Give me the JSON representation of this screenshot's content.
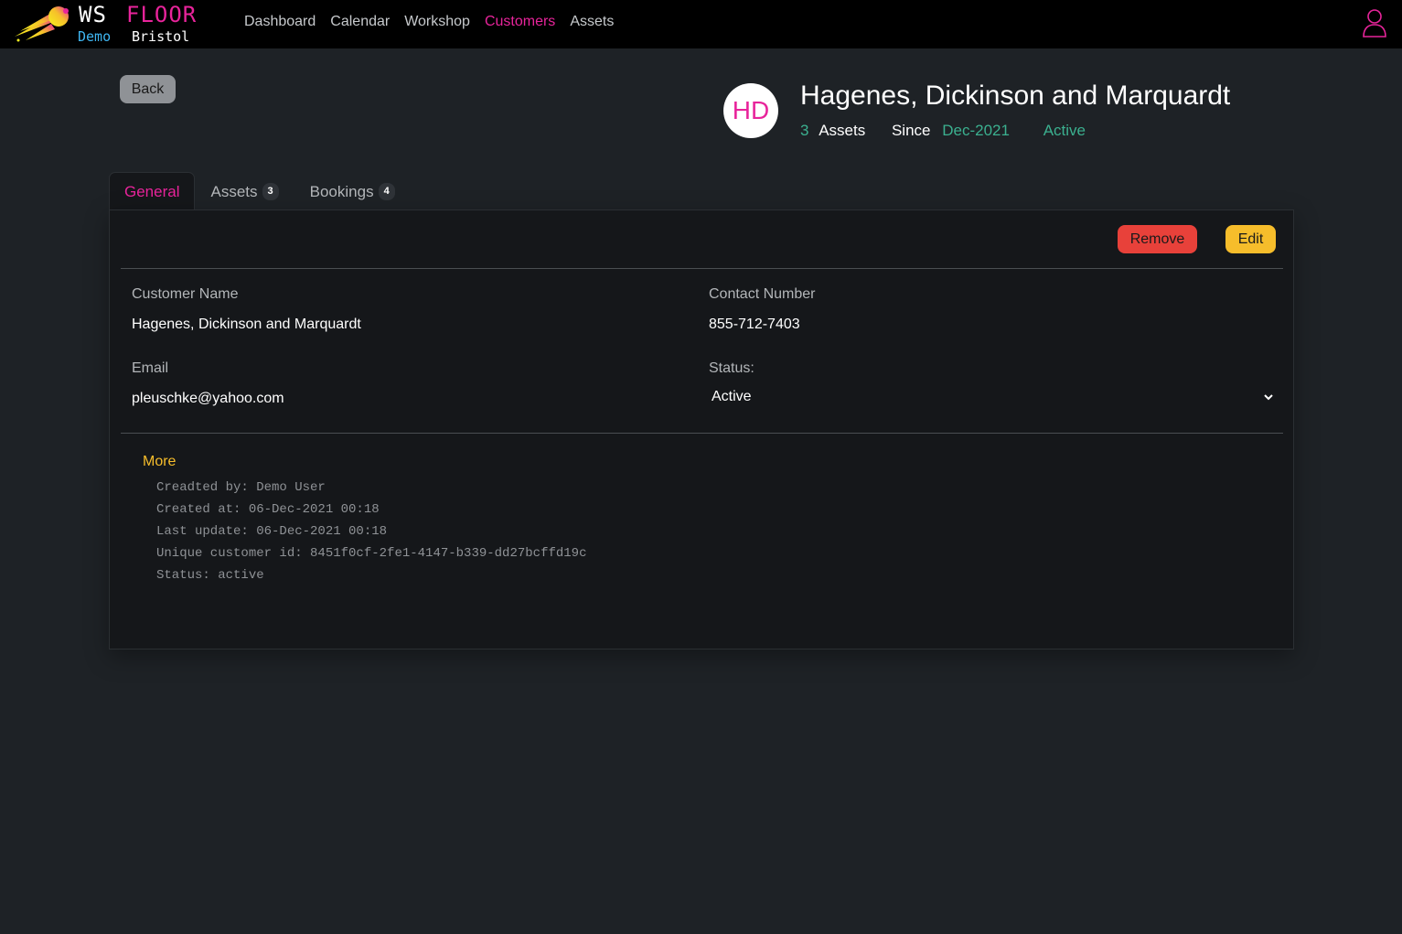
{
  "navbar": {
    "brand_ws": "WS",
    "brand_floor": "FLOOR",
    "brand_demo": "Demo",
    "brand_location": "Bristol",
    "links": [
      "Dashboard",
      "Calendar",
      "Workshop",
      "Customers",
      "Assets"
    ],
    "active_link": "Customers",
    "icons": {
      "logo": "comet-logo-icon",
      "user": "user-icon"
    },
    "colors": {
      "accent": "#e8249b",
      "demo": "#3fb6f2"
    }
  },
  "back_label": "Back",
  "customer": {
    "initials": "HD",
    "name": "Hagenes, Dickinson and Marquardt",
    "asset_count": "3",
    "assets_label": "Assets",
    "since_label": "Since",
    "since_value": "Dec-2021",
    "status": "Active"
  },
  "tabs": [
    {
      "label": "General",
      "badge": null
    },
    {
      "label": "Assets",
      "badge": "3"
    },
    {
      "label": "Bookings",
      "badge": "4"
    }
  ],
  "actions": {
    "remove_label": "Remove",
    "edit_label": "Edit"
  },
  "fields": {
    "name_label": "Customer Name",
    "name_value": "Hagenes, Dickinson and Marquardt",
    "contact_label": "Contact Number",
    "contact_value": "855-712-7403",
    "email_label": "Email",
    "email_value": "pleuschke@yahoo.com",
    "status_label": "Status:",
    "status_value": "Active"
  },
  "more": {
    "title": "More",
    "lines": [
      "Creadted by: Demo User",
      "Created at: 06-Dec-2021 00:18",
      "Last update: 06-Dec-2021 00:18",
      "Unique customer id: 8451f0cf-2fe1-4147-b339-dd27bcffd19c",
      "Status: active"
    ]
  },
  "colors": {
    "teal": "#3bb08f",
    "remove": "#e8413a",
    "edit": "#f6bd2b",
    "background": "#1e2226",
    "card": "#15171a"
  }
}
